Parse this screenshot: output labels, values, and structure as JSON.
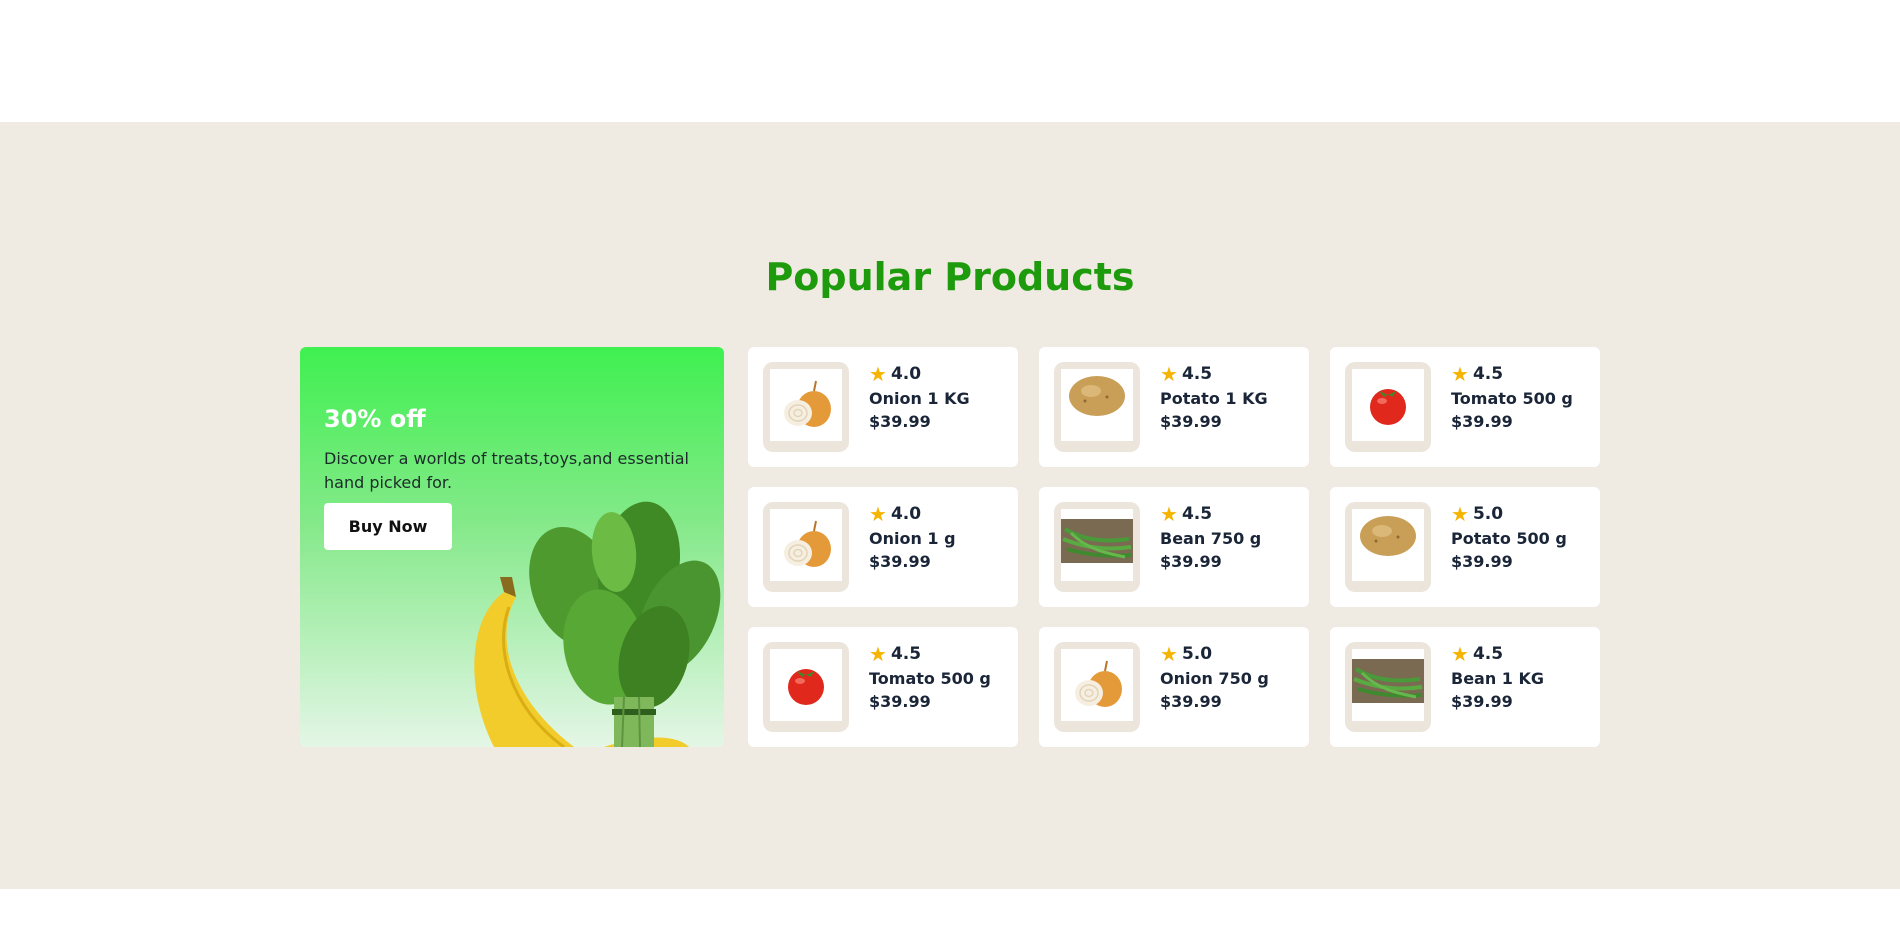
{
  "section": {
    "title": "Popular Products"
  },
  "promo": {
    "title": "30% off",
    "description": "Discover a worlds of treats,toys,and essential hand picked for.",
    "button_label": "Buy Now",
    "image": "banana-spinach-image"
  },
  "colors": {
    "title_green": "#1e9b0c",
    "section_bg": "#efeae2",
    "star": "#f5b400",
    "text_dark": "#1a2538"
  },
  "products": [
    {
      "name": "Onion 1 KG",
      "rating": "4.0",
      "price": "$39.99",
      "image": "onion"
    },
    {
      "name": "Potato 1 KG",
      "rating": "4.5",
      "price": "$39.99",
      "image": "potato"
    },
    {
      "name": "Tomato 500 g",
      "rating": "4.5",
      "price": "$39.99",
      "image": "tomato"
    },
    {
      "name": "Onion 1 g",
      "rating": "4.0",
      "price": "$39.99",
      "image": "onion"
    },
    {
      "name": "Bean 750 g",
      "rating": "4.5",
      "price": "$39.99",
      "image": "bean"
    },
    {
      "name": "Potato 500 g",
      "rating": "5.0",
      "price": "$39.99",
      "image": "potato"
    },
    {
      "name": "Tomato 500 g",
      "rating": "4.5",
      "price": "$39.99",
      "image": "tomato"
    },
    {
      "name": "Onion 750 g",
      "rating": "5.0",
      "price": "$39.99",
      "image": "onion"
    },
    {
      "name": "Bean 1 KG",
      "rating": "4.5",
      "price": "$39.99",
      "image": "bean"
    }
  ]
}
